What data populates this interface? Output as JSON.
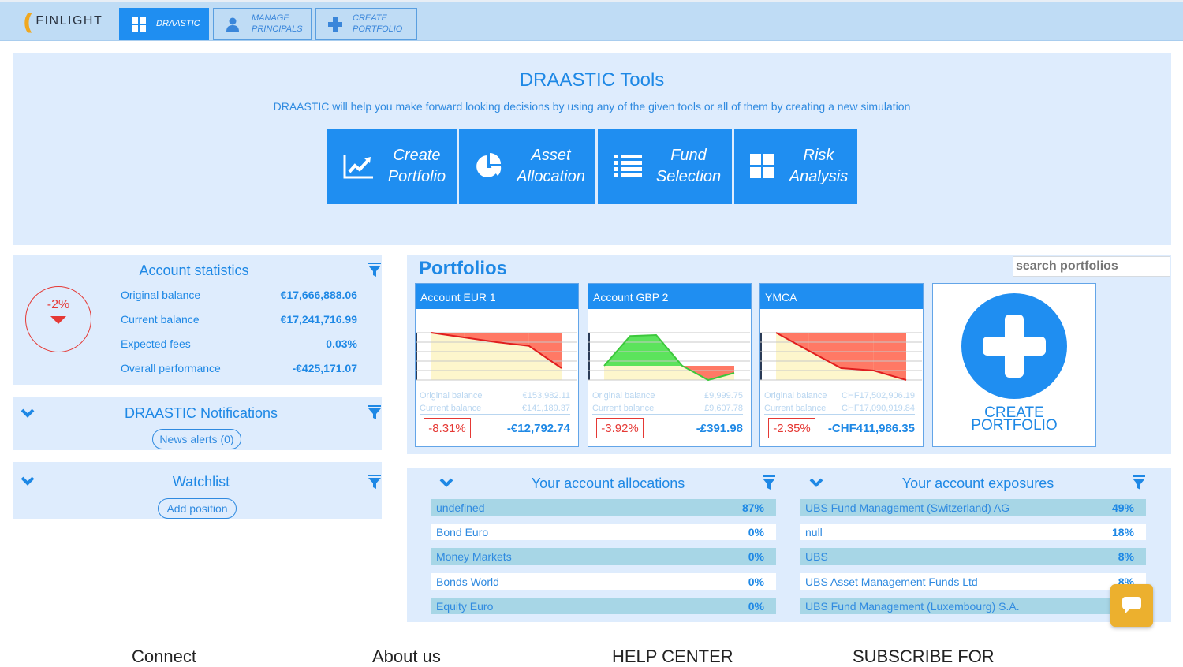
{
  "app": {
    "logo_text": "FINLIGHT"
  },
  "nav": {
    "tabs": [
      {
        "label": "DRAASTIC",
        "icon": "grid-icon",
        "active": true
      },
      {
        "label_line1": "MANAGE",
        "label_line2": "PRINCIPALS",
        "icon": "user-icon",
        "active": false
      },
      {
        "label_line1": "CREATE",
        "label_line2": "PORTFOLIO",
        "icon": "plus-icon",
        "active": false
      }
    ]
  },
  "tools": {
    "title": "DRAASTIC Tools",
    "subtitle": "DRAASTIC will help you make forward looking decisions by using any of the given tools or all of them by creating a new simulation",
    "buttons": [
      {
        "line1": "Create",
        "line2": "Portfolio",
        "icon": "line-chart-icon"
      },
      {
        "line1": "Asset",
        "line2": "Allocation",
        "icon": "pie-chart-icon"
      },
      {
        "line1": "Fund",
        "line2": "Selection",
        "icon": "list-icon"
      },
      {
        "line1": "Risk",
        "line2": "Analysis",
        "icon": "grid-icon"
      }
    ]
  },
  "account_stats": {
    "title": "Account statistics",
    "performance_pct": "-2%",
    "rows": [
      {
        "label": "Original balance",
        "value": "€17,666,888.06"
      },
      {
        "label": "Current balance",
        "value": "€17,241,716.99"
      },
      {
        "label": "Expected fees",
        "value": "0.03%"
      },
      {
        "label": "Overall performance",
        "value": "-€425,171.07"
      }
    ]
  },
  "notifications": {
    "title": "DRAASTIC Notifications",
    "button": "News alerts (0)"
  },
  "watchlist": {
    "title": "Watchlist",
    "button": "Add position"
  },
  "portfolios": {
    "title": "Portfolios",
    "search_placeholder": "search portfolios",
    "cards": [
      {
        "name": "Account EUR 1",
        "original_label": "Original balance",
        "original": "€153,982.11",
        "current_label": "Current balance",
        "current": "€141,189.37",
        "pct": "-8.31%",
        "delta": "-€12,792.74",
        "sparkline": [
          100,
          90,
          80,
          72,
          25
        ],
        "baseline": 100
      },
      {
        "name": "Account GBP 2",
        "original_label": "Original balance",
        "original": "£9,999.75",
        "current_label": "Current balance",
        "current": "£9,607.78",
        "pct": "-3.92%",
        "delta": "-£391.98",
        "sparkline": [
          30,
          93,
          95,
          30,
          0,
          15
        ],
        "baseline": 30
      },
      {
        "name": "YMCA",
        "original_label": "Original balance",
        "original": "CHF17,502,906.19",
        "current_label": "Current balance",
        "current": "CHF17,090,919.84",
        "pct": "-2.35%",
        "delta": "-CHF411,986.35",
        "sparkline": [
          100,
          62,
          25,
          20,
          0
        ],
        "baseline": 100
      }
    ],
    "create_label_line1": "CREATE",
    "create_label_line2": "PORTFOLIO"
  },
  "allocations": {
    "title": "Your account allocations",
    "rows": [
      {
        "label": "undefined",
        "pct": "87%"
      },
      {
        "label": "Bond Euro",
        "pct": "0%"
      },
      {
        "label": "Money Markets",
        "pct": "0%"
      },
      {
        "label": "Bonds World",
        "pct": "0%"
      },
      {
        "label": "Equity Euro",
        "pct": "0%"
      }
    ]
  },
  "exposures": {
    "title": "Your account exposures",
    "rows": [
      {
        "label": "UBS Fund Management (Switzerland) AG",
        "pct": "49%"
      },
      {
        "label": "null",
        "pct": "18%"
      },
      {
        "label": "UBS",
        "pct": "8%"
      },
      {
        "label": "UBS Asset Management Funds Ltd",
        "pct": "8%"
      },
      {
        "label": "UBS Fund Management (Luxembourg) S.A.",
        "pct": ""
      }
    ]
  },
  "footer": {
    "headings": [
      "Connect",
      "About us",
      "HELP CENTER",
      "SUBSCRIBE FOR"
    ]
  },
  "colors": {
    "accent": "#1f8ef1",
    "negative": "#e53935",
    "positive": "#4ae04a",
    "chat": "#ecb02e"
  }
}
